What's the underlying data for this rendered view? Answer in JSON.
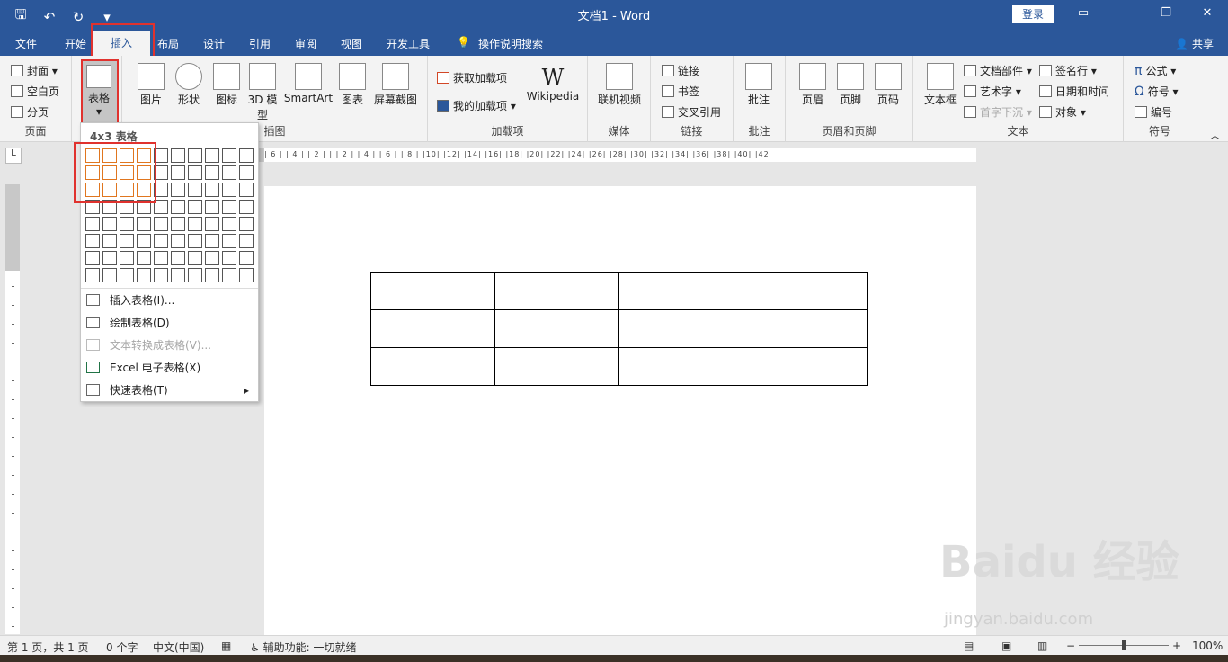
{
  "title_bar": {
    "title": "文档1  -  Word",
    "login": "登录",
    "save_icon": "save-icon",
    "undo_icon": "undo-icon",
    "redo_icon": "redo-icon"
  },
  "tabs": [
    "文件",
    "开始",
    "插入",
    "布局",
    "设计",
    "引用",
    "审阅",
    "视图",
    "开发工具",
    "操作说明搜索"
  ],
  "active_tab": "插入",
  "share": "共享",
  "ribbon": {
    "pages": {
      "label": "页面",
      "items": [
        "封面",
        "空白页",
        "分页"
      ]
    },
    "tables": {
      "label": "表格",
      "button": "表格"
    },
    "illustrations": {
      "label": "插图",
      "items": [
        "图片",
        "形状",
        "图标",
        "3D 模型",
        "SmartArt",
        "图表",
        "屏幕截图"
      ]
    },
    "addins": {
      "label": "加载项",
      "items": [
        "获取加载项",
        "我的加载项",
        "Wikipedia"
      ]
    },
    "media": {
      "label": "媒体",
      "items": [
        "联机视频"
      ]
    },
    "links": {
      "label": "链接",
      "items": [
        "链接",
        "书签",
        "交叉引用"
      ]
    },
    "comments": {
      "label": "批注",
      "items": [
        "批注"
      ]
    },
    "header_footer": {
      "label": "页眉和页脚",
      "items": [
        "页眉",
        "页脚",
        "页码"
      ]
    },
    "text": {
      "label": "文本",
      "items": [
        "文本框",
        "文档部件",
        "艺术字",
        "首字下沉",
        "签名行",
        "日期和时间",
        "对象"
      ]
    },
    "symbols": {
      "label": "符号",
      "items": [
        "公式",
        "符号",
        "编号"
      ]
    }
  },
  "table_dropdown": {
    "title": "4x3 表格",
    "grid": {
      "cols": 10,
      "rows": 8,
      "highlight_cols": 4,
      "highlight_rows": 3
    },
    "menu": [
      {
        "label": "插入表格(I)...",
        "disabled": false
      },
      {
        "label": "绘制表格(D)",
        "disabled": false
      },
      {
        "label": "文本转换成表格(V)...",
        "disabled": true
      },
      {
        "label": "Excel 电子表格(X)",
        "disabled": false
      },
      {
        "label": "快速表格(T)",
        "disabled": false
      }
    ]
  },
  "ruler_h": "| 6 |  | 4 |  | 2 |  |    | 2 |  | 4 |  | 6 |  | 8 |  |10|  |12|  |14|  |16|  |18|  |20|  |22|  |24|  |26|  |28|  |30|  |32|  |34|  |36|  |38|  |40|  |42",
  "document_table": {
    "rows": 3,
    "cols": 4
  },
  "status_bar": {
    "page": "第 1 页，共 1 页",
    "words": "0 个字",
    "language": "中文(中国)",
    "accessibility": "辅助功能: 一切就绪",
    "zoom": "100%"
  },
  "watermark": {
    "line1": "Baidu 经验",
    "line2": "jingyan.baidu.com"
  }
}
